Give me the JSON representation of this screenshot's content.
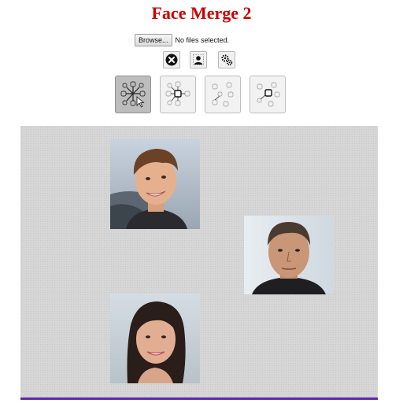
{
  "app": {
    "title": "Face Merge 2"
  },
  "file_input": {
    "button_label": "Browse...",
    "status": "No files selected."
  },
  "toolbar": [
    {
      "name": "clear-button",
      "icon": "close-circle-icon"
    },
    {
      "name": "add-face-button",
      "icon": "person-icon"
    },
    {
      "name": "settings-button",
      "icon": "gears-icon"
    }
  ],
  "modes": [
    {
      "name": "mode-star",
      "icon": "star-graph-icon",
      "active": true
    },
    {
      "name": "mode-center-square",
      "icon": "center-square-graph-icon",
      "active": false
    },
    {
      "name": "mode-diagonal",
      "icon": "diagonal-graph-icon",
      "active": false
    },
    {
      "name": "mode-square-link",
      "icon": "square-link-graph-icon",
      "active": false
    }
  ],
  "faces": [
    {
      "name": "face-young-man",
      "description_icon": "photo-icon"
    },
    {
      "name": "face-middle-aged-man",
      "description_icon": "photo-icon"
    },
    {
      "name": "face-woman",
      "description_icon": "photo-icon"
    }
  ],
  "progress": {
    "value": 1.0,
    "color": "#5b2aa8"
  }
}
